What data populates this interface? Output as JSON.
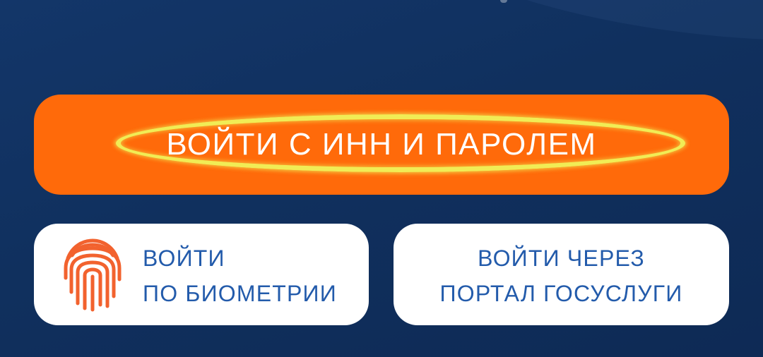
{
  "login_screen": {
    "primary_button": {
      "label": "ВОЙТИ С ИНН И ПАРОЛЕМ"
    },
    "biometric_button": {
      "line1": "ВОЙТИ",
      "line2": "ПО БИОМЕТРИИ",
      "icon": "fingerprint-icon"
    },
    "gosuslugi_button": {
      "line1": "ВОЙТИ ЧЕРЕЗ",
      "line2": "ПОРТАЛ ГОСУСЛУГИ"
    }
  },
  "colors": {
    "background": "#10305e",
    "primary_button": "#ff6a0a",
    "highlight_ring": "#f1ec55",
    "card_background": "#ffffff",
    "card_text": "#235bab",
    "fingerprint": "#f2622e"
  }
}
